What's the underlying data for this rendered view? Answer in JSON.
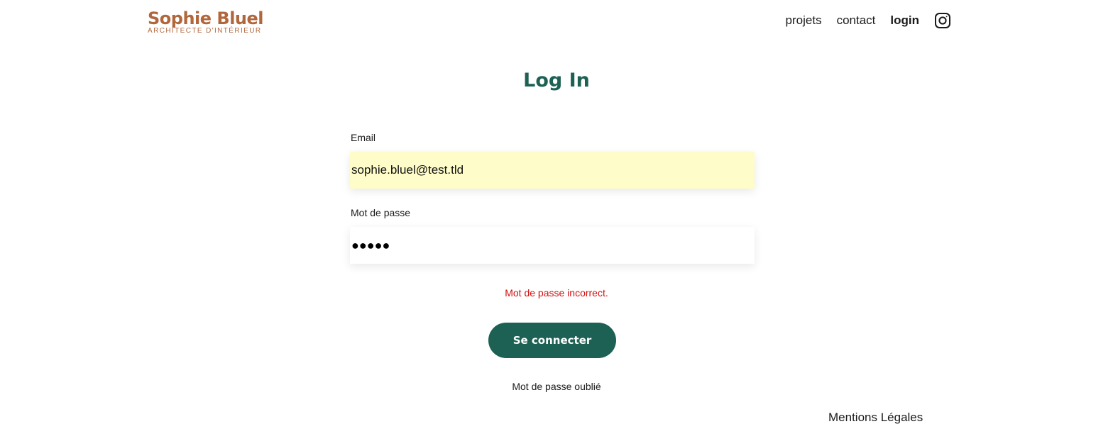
{
  "brand": {
    "title": "Sophie Bluel",
    "subtitle": "ARCHITECTE D'INTÉRIEUR",
    "color": "#B1663C"
  },
  "nav": {
    "items": [
      {
        "label": "projets"
      },
      {
        "label": "contact"
      },
      {
        "label": "login",
        "active": true
      }
    ],
    "social_icon": "instagram-icon"
  },
  "page": {
    "title": "Log In",
    "title_color": "#1D6154"
  },
  "form": {
    "email_label": "Email",
    "email_value": "sophie.bluel@test.tld",
    "password_label": "Mot de passe",
    "password_masked": "●●●●●",
    "error_message": "Mot de passe incorrect.",
    "submit_label": "Se connecter",
    "forgot_label": "Mot de passe oublié"
  },
  "footer": {
    "legal_label": "Mentions Légales"
  },
  "colors": {
    "accent": "#1D6154",
    "error": "#D01010",
    "autofill_bg": "#FEFCC8"
  }
}
